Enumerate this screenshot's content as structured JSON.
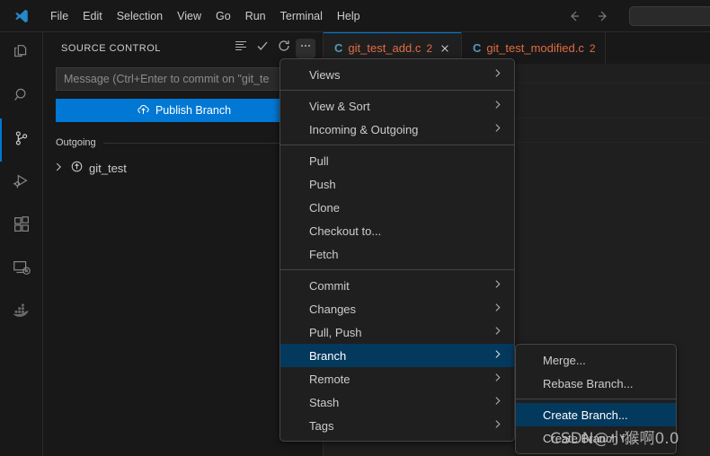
{
  "window": {
    "logo_icon": "vscode-logo-icon",
    "menu_items": [
      "File",
      "Edit",
      "Selection",
      "View",
      "Go",
      "Run",
      "Terminal",
      "Help"
    ],
    "nav_back_icon": "arrow-left-icon",
    "nav_forward_icon": "arrow-right-icon",
    "search_placeholder": ""
  },
  "activity_bar": {
    "items": [
      {
        "name": "explorer",
        "icon": "files-icon",
        "active": false
      },
      {
        "name": "search",
        "icon": "search-icon",
        "active": false
      },
      {
        "name": "source-control",
        "icon": "source-control-icon",
        "active": true
      },
      {
        "name": "run-and-debug",
        "icon": "run-debug-icon",
        "active": false
      },
      {
        "name": "extensions",
        "icon": "extensions-icon",
        "active": false
      },
      {
        "name": "remote-explorer",
        "icon": "remote-explorer-icon",
        "active": false
      },
      {
        "name": "docker",
        "icon": "docker-icon",
        "active": false
      }
    ]
  },
  "sidebar": {
    "title": "SOURCE CONTROL",
    "actions": [
      {
        "name": "view-as-list",
        "icon": "list-icon"
      },
      {
        "name": "commit",
        "icon": "check-icon"
      },
      {
        "name": "refresh",
        "icon": "refresh-icon"
      },
      {
        "name": "more-actions",
        "icon": "ellipsis-icon"
      }
    ],
    "commit_input": {
      "placeholder": "Message (Ctrl+Enter to commit on \"git_te",
      "value": ""
    },
    "publish_button": {
      "label": "Publish Branch",
      "icon": "cloud-upload-icon"
    },
    "outgoing": {
      "label": "Outgoing",
      "items": [
        {
          "label": "git_test",
          "icon": "arrow-circle-up-icon",
          "expand_icon": "chevron-right-icon"
        }
      ]
    }
  },
  "editor": {
    "tabs": [
      {
        "icon": "c-file-icon",
        "label": "git_test_add.c",
        "badge": "2",
        "active": true,
        "close_icon": "close-icon"
      },
      {
        "icon": "c-file-icon",
        "label": "git_test_modified.c",
        "badge": "2",
        "active": false,
        "close_icon": "close-icon"
      }
    ]
  },
  "context_menu": {
    "groups": [
      {
        "items": [
          {
            "label": "Views",
            "submenu": true
          }
        ]
      },
      {
        "items": [
          {
            "label": "View & Sort",
            "submenu": true
          },
          {
            "label": "Incoming & Outgoing",
            "submenu": true
          }
        ]
      },
      {
        "items": [
          {
            "label": "Pull",
            "submenu": false
          },
          {
            "label": "Push",
            "submenu": false
          },
          {
            "label": "Clone",
            "submenu": false
          },
          {
            "label": "Checkout to...",
            "submenu": false
          },
          {
            "label": "Fetch",
            "submenu": false
          }
        ]
      },
      {
        "items": [
          {
            "label": "Commit",
            "submenu": true
          },
          {
            "label": "Changes",
            "submenu": true
          },
          {
            "label": "Pull, Push",
            "submenu": true
          },
          {
            "label": "Branch",
            "submenu": true,
            "selected": true
          },
          {
            "label": "Remote",
            "submenu": true
          },
          {
            "label": "Stash",
            "submenu": true
          },
          {
            "label": "Tags",
            "submenu": true
          }
        ]
      }
    ]
  },
  "branch_submenu": {
    "groups": [
      {
        "items": [
          {
            "label": "Merge...",
            "submenu": false
          },
          {
            "label": "Rebase Branch...",
            "submenu": false
          }
        ]
      },
      {
        "items": [
          {
            "label": "Create Branch...",
            "submenu": false,
            "selected": true
          },
          {
            "label": "Create Branch f...",
            "submenu": false
          }
        ]
      }
    ]
  },
  "watermark": {
    "text": "CSDN@小猴啊0.0"
  },
  "colors": {
    "accent": "#0078d4",
    "menu_selected": "#04395e",
    "git_modified": "#e06c45",
    "background": "#1f1f1f",
    "chrome": "#181818"
  }
}
